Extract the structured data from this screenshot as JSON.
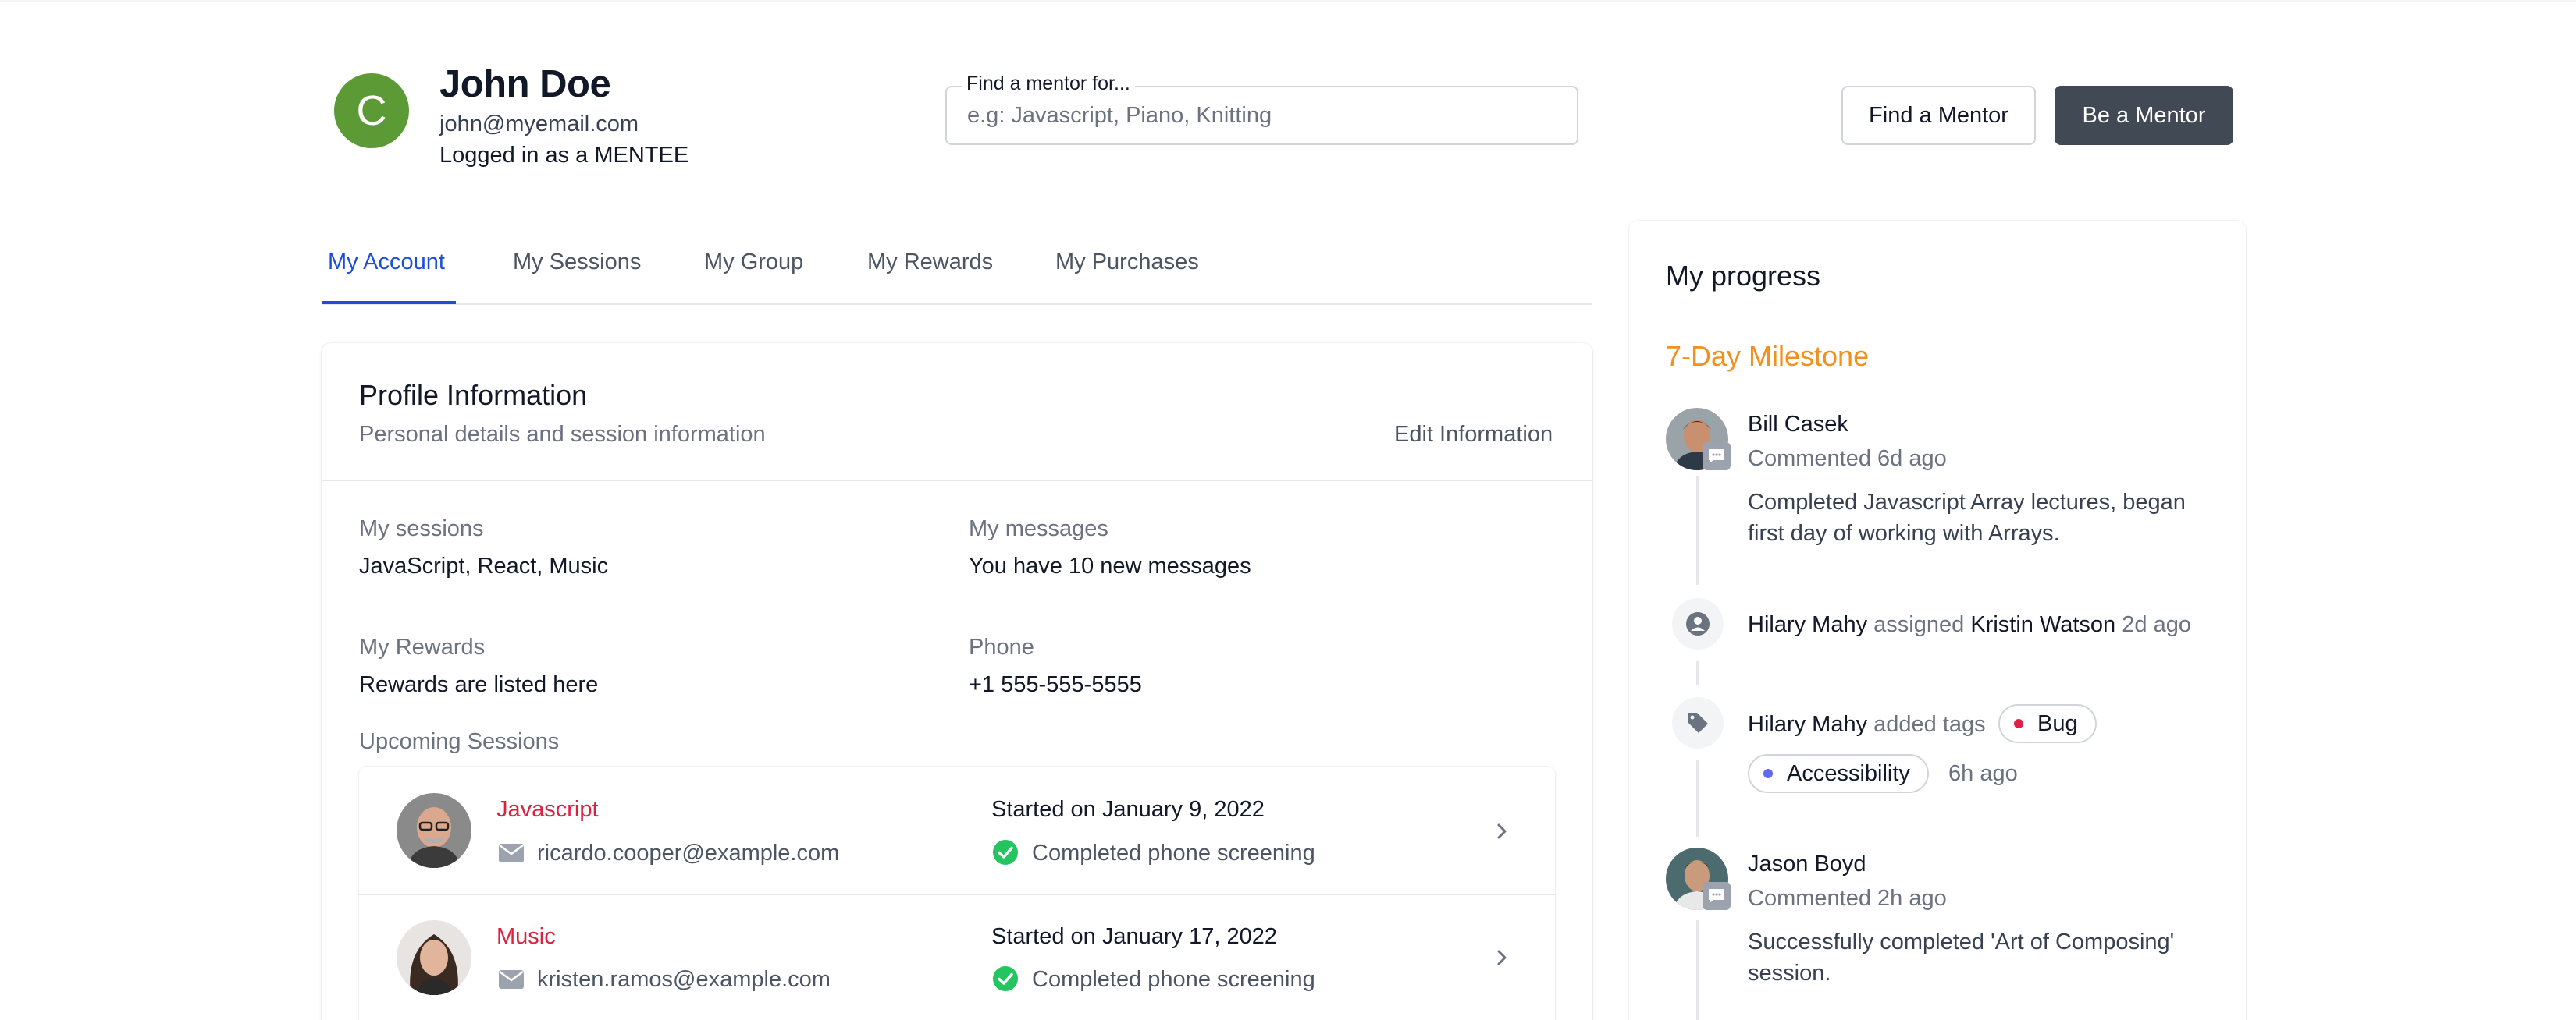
{
  "user": {
    "avatar_initial": "C",
    "name": "John Doe",
    "email": "john@myemail.com",
    "role_text": "Logged in as a MENTEE"
  },
  "search": {
    "legend": "Find a mentor for...",
    "placeholder": "e.g: Javascript, Piano, Knitting",
    "value": ""
  },
  "header_buttons": {
    "find": "Find a Mentor",
    "be": "Be a Mentor"
  },
  "tabs": [
    {
      "label": "My Account",
      "active": true
    },
    {
      "label": "My Sessions",
      "active": false
    },
    {
      "label": "My Group",
      "active": false
    },
    {
      "label": "My Rewards",
      "active": false
    },
    {
      "label": "My Purchases",
      "active": false
    }
  ],
  "profile": {
    "title": "Profile Information",
    "subtitle": "Personal details and session information",
    "edit_label": "Edit Information",
    "fields": {
      "sessions_label": "My sessions",
      "sessions_value": "JavaScript, React, Music",
      "messages_label": "My messages",
      "messages_value": "You have 10 new messages",
      "rewards_label": "My Rewards",
      "rewards_value": "Rewards are listed here",
      "phone_label": "Phone",
      "phone_value": "+1 555-555-5555"
    },
    "upcoming_label": "Upcoming Sessions",
    "sessions": [
      {
        "title": "Javascript",
        "email": "ricardo.cooper@example.com",
        "date_text": "Started on January 9, 2022",
        "status": "Completed phone screening"
      },
      {
        "title": "Music",
        "email": "kristen.ramos@example.com",
        "date_text": "Started on January 17, 2022",
        "status": "Completed phone screening"
      }
    ]
  },
  "progress": {
    "title": "My progress",
    "milestone": "7-Day Milestone",
    "items": [
      {
        "name": "Bill Casek",
        "meta": "Commented 6d ago",
        "body_line1": "Completed Javascript Array lectures, began",
        "body_line2": "first day of working with Arrays."
      },
      {
        "actor": "Hilary Mahy",
        "verb": "assigned",
        "target": "Kristin Watson",
        "time": "2d ago"
      },
      {
        "actor": "Hilary Mahy",
        "verb": "added tags",
        "tags": [
          {
            "label": "Bug",
            "color": "#e11d48"
          },
          {
            "label": "Accessibility",
            "color": "#6366f1"
          }
        ],
        "time": "6h ago"
      },
      {
        "name": "Jason Boyd",
        "meta": "Commented 2h ago",
        "body_line1": "Successfully completed 'Art of Composing'",
        "body_line2": "session."
      }
    ]
  },
  "colors": {
    "accent_blue": "#1d4ed8",
    "milestone_orange": "#f0901e",
    "session_title_red": "#dc2040",
    "dark_button": "#404954",
    "success_green": "#22c55e"
  }
}
